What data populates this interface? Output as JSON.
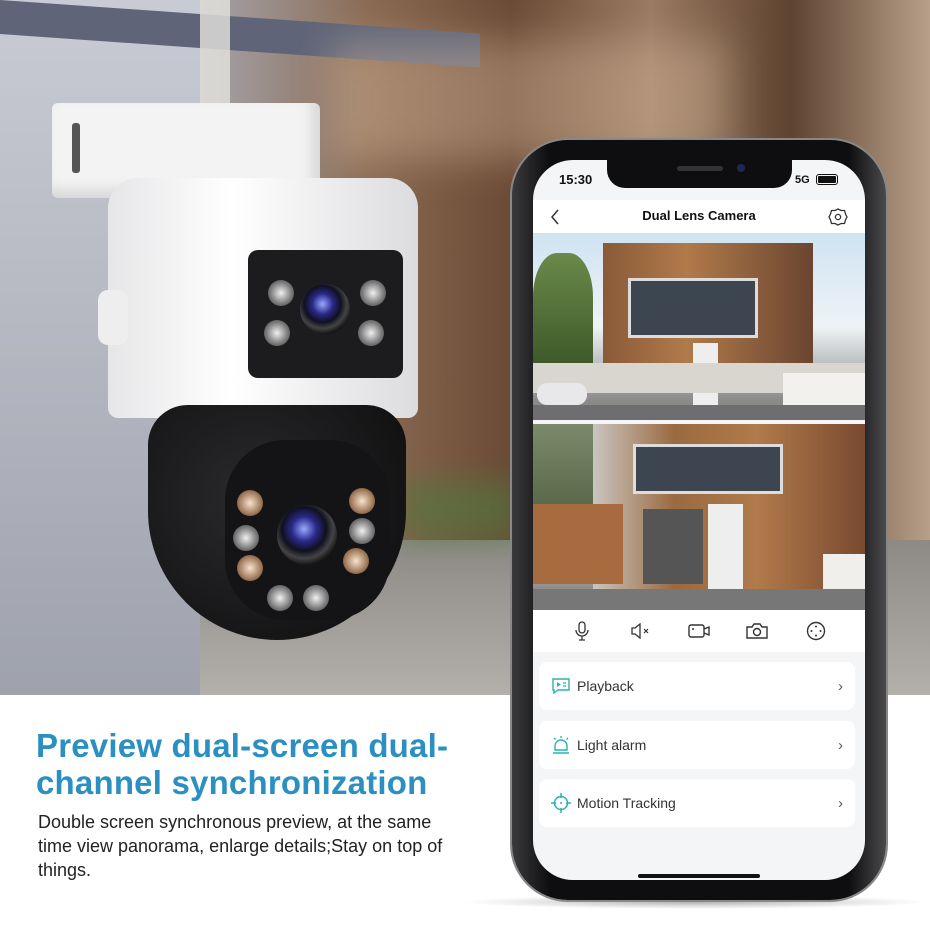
{
  "hero": {
    "heading_line1": "Preview dual-screen dual-",
    "heading_line2": "channel synchronization",
    "description": "Double screen synchronous preview, at the same time view panorama, enlarge details;Stay on top of things.",
    "heading_color": "#2b8fc2"
  },
  "phone": {
    "status": {
      "time": "15:30",
      "network": "5G",
      "battery_icon": "battery-icon"
    },
    "header": {
      "title": "Dual Lens Camera",
      "back_icon": "chevron-left-icon",
      "settings_icon": "gear-icon"
    },
    "toolbar": [
      {
        "icon": "microphone-icon"
      },
      {
        "icon": "mute-icon"
      },
      {
        "icon": "record-video-icon"
      },
      {
        "icon": "camera-snapshot-icon"
      },
      {
        "icon": "ptz-control-icon"
      }
    ],
    "menu": [
      {
        "label": "Playback",
        "icon": "playback-icon"
      },
      {
        "label": "Light alarm",
        "icon": "alarm-light-icon"
      },
      {
        "label": "Motion Tracking",
        "icon": "crosshair-icon"
      }
    ],
    "accent": "#2bb3b0"
  }
}
